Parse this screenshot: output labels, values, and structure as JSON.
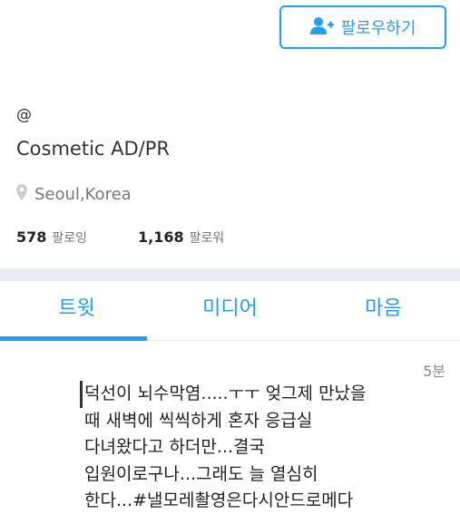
{
  "profile": {
    "follow_label": "팔로우하기",
    "handle": "@",
    "bio": "Cosmetic AD/PR",
    "location": "Seoul,Korea",
    "following_count": "578",
    "following_label": "팔로잉",
    "followers_count": "1,168",
    "followers_label": "팔로워"
  },
  "tabs": [
    {
      "label": "트윗",
      "active": true
    },
    {
      "label": "미디어",
      "active": false
    },
    {
      "label": "마음",
      "active": false
    }
  ],
  "tweet": {
    "time": "5분",
    "lines": [
      "덕선이 뇌수막염.....ㅜㅜ 엊그제 만났을",
      "때 새벽에 씩씩하게 혼자 응급실",
      "다녀왔다고 하더만...결국",
      "입원이로구나...그래도 늘 열심히",
      "한다...#낼모레촬영은다시안드로메다"
    ]
  },
  "colors": {
    "accent": "#1da1f2",
    "muted": "#777777",
    "divider": "#e6ecf0"
  },
  "icons": {
    "follow": "add-person-icon",
    "location": "map-pin-icon"
  }
}
